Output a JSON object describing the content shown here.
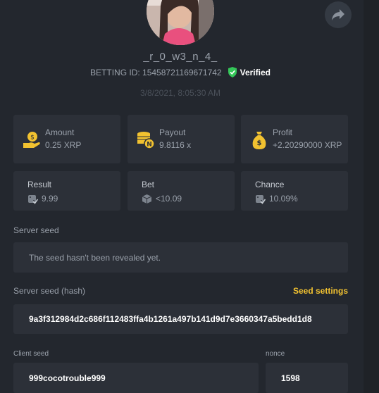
{
  "profile": {
    "username": "_r_0_w3_n_4_",
    "betting_id": "BETTING ID: 15458721169671742",
    "verified_label": "Verified",
    "date": "3/8/2021, 8:05:30 AM"
  },
  "stats_top": [
    {
      "label": "Amount",
      "value": "0.25 XRP",
      "icon": "money-bag-hand-icon"
    },
    {
      "label": "Payout",
      "value": "9.8116 x",
      "icon": "coin-stack-icon"
    },
    {
      "label": "Profit",
      "value": "+2.20290000 XRP",
      "icon": "money-bag-icon"
    }
  ],
  "stats_bottom": [
    {
      "label": "Result",
      "value": "9.99",
      "icon": "dice-icon"
    },
    {
      "label": "Bet",
      "value": "<10.09",
      "icon": "cube-icon"
    },
    {
      "label": "Chance",
      "value": "10.09%",
      "icon": "dice-icon"
    }
  ],
  "server_seed": {
    "label": "Server seed",
    "value": "The seed hasn't been revealed yet."
  },
  "server_seed_hash": {
    "label": "Server seed (hash)",
    "settings_link": "Seed settings",
    "value": "9a3f312984d2c686f112483ffa4b1261a497b141d9d7e3660347a5bedd1d8"
  },
  "client_seed": {
    "label": "Client seed",
    "value": "999cocotrouble999"
  },
  "nonce": {
    "label": "nonce",
    "value": "1598"
  },
  "colors": {
    "accent": "#f2c230",
    "verified": "#34c759",
    "background": "#23272e",
    "card": "#2c3038"
  }
}
